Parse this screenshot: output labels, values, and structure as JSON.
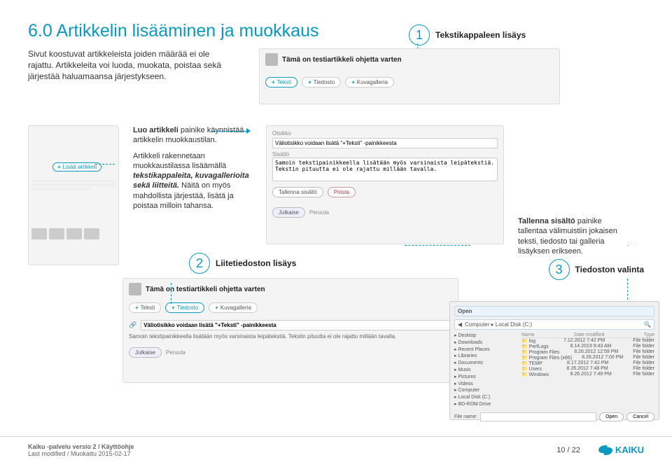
{
  "title": "6.0 Artikkelin lisääminen ja muokkaus",
  "callouts": {
    "c1": {
      "num": "1",
      "label": "Tekstikappaleen lisäys"
    },
    "c2": {
      "num": "2",
      "label": "Liitetiedoston lisäys"
    },
    "c3": {
      "num": "3",
      "label": "Tiedoston valinta"
    }
  },
  "intro": "Sivut koostuvat artikkeleista joiden määrää ei ole rajattu. Artikkeleita voi luoda, muokata, poistaa sekä järjestää haluamaansa järjestykseen.",
  "mid": {
    "p1a": "Luo artikkeli",
    "p1b": " painike käynnistää artikkelin muokkaustilan.",
    "p2": "Artikkeli rakennetaan muokkaustilassa lisäämällä ",
    "p2i": "tekstikappaleita, kuvagallerioita sekä liitteitä.",
    "p2b": " Näitä on myös mahdollista järjestää, lisätä ja poistaa milloin tahansa.",
    "right": "Tallenna sisältö",
    "right_rest": " painike tallentaa välimuistiin jokaisen teksti, tiedosto tai galleria lisäyksen erikseen."
  },
  "ss1": {
    "heading": "Tämä on testiartikkeli ohjetta varten",
    "tab_text": "Teksti",
    "tab_file": "Tiedosto",
    "tab_gallery": "Kuvagalleria"
  },
  "leftshot": {
    "add_article": "Lisää artikkeli"
  },
  "ss2": {
    "otsikko_lbl": "Otsikko",
    "otsikko_val": "Väliotisikko voidaan lisätä \"+Teksti\" -painikkeesta",
    "sisalto_lbl": "Sisältö",
    "sisalto_val": "Samoin tekstipainikkeella lisätään myös varsinaista leipätekstiä. Tekstin pituutta ei ole rajattu millään tavalla.",
    "save": "Tallenna sisältö",
    "delete": "Poista",
    "publish": "Julkaise",
    "cancel": "Peruuta"
  },
  "ss3": {
    "heading": "Tämä on testiartikkeli ohjetta varten",
    "tab_text": "Teksti",
    "tab_file": "Tiedosto",
    "tab_gallery": "Kuvagalleria",
    "field_val": "Väliotisikko voidaan lisätä \"+Teksti\" -painikkeesta",
    "desc": "Samoin tekstipainikkeella lisätään myös varsinaista leipätekstiä. Tekstin pituutta ei ole rajattu millään tavalla.",
    "publish": "Julkaise",
    "cancel": "Peruuta"
  },
  "ss4": {
    "title": "Open",
    "path_lbl": "Computer ▸ Local Disk (C:)",
    "tree": [
      "Desktop",
      "Downloads",
      "Recent Places",
      "Libraries",
      "Documents",
      "Music",
      "Pictures",
      "Videos",
      "Computer",
      "Local Disk (C:)",
      "BD-ROM Drive"
    ],
    "cols": [
      "Name",
      "Date modified",
      "Type"
    ],
    "files": [
      {
        "n": "log",
        "d": "7.12.2012 7:42 PM",
        "t": "File folder"
      },
      {
        "n": "PerfLogs",
        "d": "8.14.2019 9:43 AM",
        "t": "File folder"
      },
      {
        "n": "Program Files",
        "d": "8.26.2012 12:59 PM",
        "t": "File folder"
      },
      {
        "n": "Program Files (x86)",
        "d": "8.26.2012 7:00 PM",
        "t": "File folder"
      },
      {
        "n": "TEMP",
        "d": "8.17.2012 7:42 PM",
        "t": "File folder"
      },
      {
        "n": "Users",
        "d": "8.26.2012 7:48 PM",
        "t": "File folder"
      },
      {
        "n": "Windows",
        "d": "8.26.2012 7:49 PM",
        "t": "File folder"
      }
    ],
    "filename_lbl": "File name:",
    "open": "Open",
    "cancel": "Cancel"
  },
  "footer": {
    "line1": "Kaiku -palvelu versio 2 / Käyttöohje",
    "line2": "Last modified / Muokattu 2015-02-17",
    "page": "10 / 22",
    "brand": "KAIKU"
  }
}
